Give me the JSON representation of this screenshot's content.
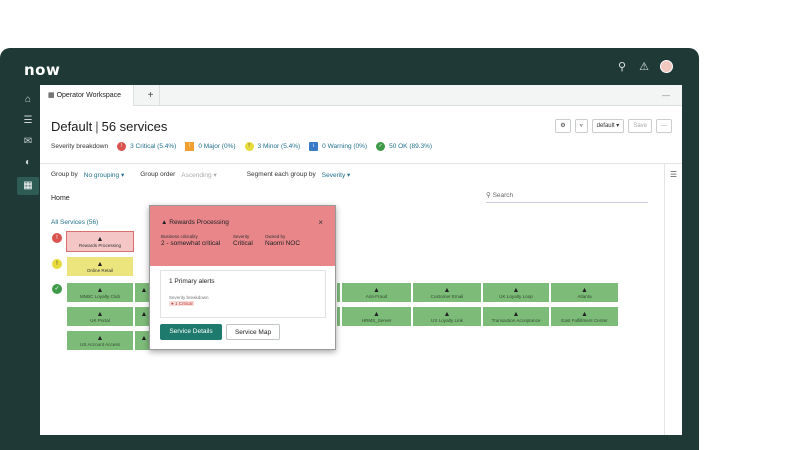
{
  "app": {
    "logo": "now"
  },
  "tabs": {
    "active": "Operator Workspace",
    "add": "+",
    "more": "—"
  },
  "header": {
    "title": "Default",
    "subtitle": "56 services",
    "toolbar": {
      "settings_icon": "gear-icon",
      "filter_icon": "filter-icon",
      "dropdown": "default ▾",
      "save": "Save",
      "more": "···"
    }
  },
  "severity": {
    "label": "Severity breakdown",
    "items": [
      {
        "text": "3 Critical (5.4%)",
        "color": "#d9534f",
        "icon": "critical-icon"
      },
      {
        "text": "0 Major (0%)",
        "color": "#f0a030",
        "icon": "major-icon"
      },
      {
        "text": "3 Minor (5.4%)",
        "color": "#e6da3c",
        "icon": "minor-icon"
      },
      {
        "text": "0 Warning (0%)",
        "color": "#3a7bc8",
        "icon": "warning-icon"
      },
      {
        "text": "50 OK (89.3%)",
        "color": "#3f9b49",
        "icon": "ok-icon"
      }
    ]
  },
  "grouping": {
    "group_by_label": "Group by",
    "group_by_value": "No grouping ▾",
    "group_order_label": "Group order",
    "group_order_value": "Ascending ▾",
    "segment_label": "Segment each group by",
    "segment_value": "Severity ▾"
  },
  "breadcrumb": {
    "home": "Home"
  },
  "search": {
    "placeholder": "Search"
  },
  "all_services": "All Services (56)",
  "tiles": {
    "critical": [
      "Rewards Processing"
    ],
    "minor": [
      "Online Retail"
    ],
    "ok_row1": [
      "MNBC Loyalty Club",
      "",
      "",
      "",
      "",
      "Anti-Fraud",
      "Customer Email",
      "UK Loyalty Loop",
      "Atlanta"
    ],
    "ok_row2": [
      "UK Portal",
      "",
      "",
      "",
      "",
      "HRMS_Server",
      "US Loyalty Link",
      "Transaction Acceptance",
      "East Fulfillment Center"
    ],
    "ok_row3": [
      "US Account Access",
      ""
    ]
  },
  "popup": {
    "title": "Rewards Processing",
    "close": "×",
    "meta": [
      {
        "label": "Business criticality",
        "value": "2 - somewhat critical"
      },
      {
        "label": "Severity",
        "value": "Critical"
      },
      {
        "label": "Owned by",
        "value": "Naomi NOC"
      }
    ],
    "alerts_title": "1 Primary alerts",
    "alerts_sev_label": "Severity breakdown",
    "alerts_badge": "● 1 Critical",
    "service_details": "Service Details",
    "service_map": "Service Map"
  }
}
